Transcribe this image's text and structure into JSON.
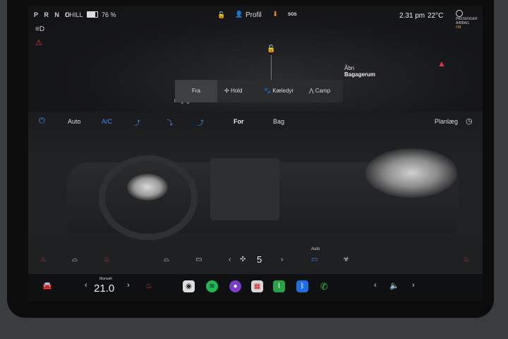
{
  "status": {
    "gear": "P R N D",
    "drive_mode": "CHILL",
    "battery_pct": "76 %",
    "battery_level": 0.76,
    "profile": "Profil",
    "sos": "SOS",
    "time": "2.31 pm",
    "temperature": "22°C",
    "airbag_label": "PASSENGER AIRBAG",
    "airbag_state": "ON"
  },
  "car": {
    "trunk_action": "Åbn",
    "trunk_label": "Bagagerum",
    "frunk_label": "Bagagerum"
  },
  "climate_modes": {
    "items": [
      "Fra",
      "Hold",
      "Kæledyr",
      "Camp"
    ],
    "selected": "Fra"
  },
  "hvac": {
    "auto": "Auto",
    "ac": "A/C",
    "front": "For",
    "rear": "Bag",
    "schedule": "Planlæg",
    "fan_speed": "5",
    "auto_small": "Auto",
    "accent": "#3a8ff5",
    "warn": "#e23b3b"
  },
  "taskbar": {
    "driver_temp": "21.0",
    "temp_mode": "Manuelt"
  }
}
